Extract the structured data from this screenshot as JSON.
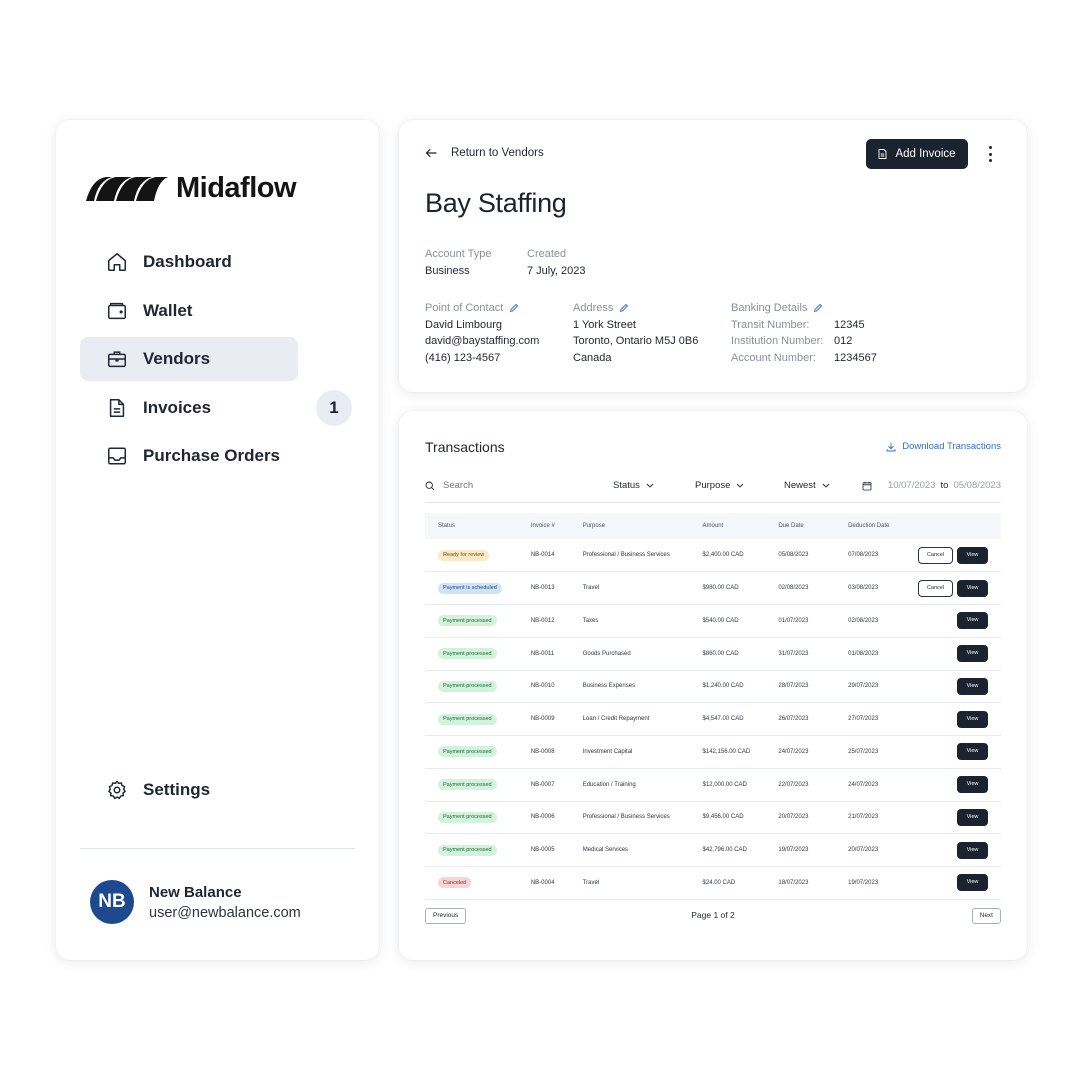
{
  "app": {
    "logo_text": "Midaflow"
  },
  "sidebar": {
    "items": [
      {
        "label": "Dashboard",
        "icon": "home-icon"
      },
      {
        "label": "Wallet",
        "icon": "wallet-icon"
      },
      {
        "label": "Vendors",
        "icon": "briefcase-icon",
        "active": true
      },
      {
        "label": "Invoices",
        "icon": "document-icon",
        "badge": "1"
      },
      {
        "label": "Purchase Orders",
        "icon": "inbox-icon"
      }
    ],
    "settings_label": "Settings",
    "user": {
      "initials": "NB",
      "name": "New Balance",
      "email": "user@newbalance.com"
    }
  },
  "vendor": {
    "back_label": "Return to Vendors",
    "add_invoice_label": "Add Invoice",
    "name": "Bay Staffing",
    "account_type_label": "Account Type",
    "account_type": "Business",
    "created_label": "Created",
    "created": "7 July, 2023",
    "contact_label": "Point of Contact",
    "contact_name": "David Limbourg",
    "contact_email": "david@baystaffing.com",
    "contact_phone": "(416) 123-4567",
    "address_label": "Address",
    "address_line1": "1 York Street",
    "address_line2": "Toronto, Ontario M5J 0B6",
    "address_line3": "Canada",
    "banking_label": "Banking Details",
    "transit_label": "Transit Number:",
    "transit": "12345",
    "institution_label": "Institution Number:",
    "institution": "012",
    "account_label": "Account Number:",
    "account": "1234567"
  },
  "transactions": {
    "title": "Transactions",
    "download_label": "Download Transactions",
    "search_placeholder": "Search",
    "status_filter": "Status",
    "purpose_filter": "Purpose",
    "sort": "Newest",
    "date_from": "10/07/2023",
    "date_to_label": "to",
    "date_to": "05/08/2023",
    "columns": [
      "Status",
      "Invoice #",
      "Purpose",
      "Amount",
      "Due Date",
      "Deduction Date"
    ],
    "cancel_label": "Cancel",
    "view_label": "View",
    "rows": [
      {
        "status": "Ready for review",
        "kind": "review",
        "invoice": "NB-0014",
        "purpose": "Professional / Business Services",
        "amount": "$2,400.00 CAD",
        "due": "05/08/2023",
        "deduction": "07/08/2023",
        "cancel": true
      },
      {
        "status": "Payment is scheduled",
        "kind": "scheduled",
        "invoice": "NB-0013",
        "purpose": "Travel",
        "amount": "$980.00 CAD",
        "due": "02/08/2023",
        "deduction": "03/08/2023",
        "cancel": true
      },
      {
        "status": "Payment processed",
        "kind": "processed",
        "invoice": "NB-0012",
        "purpose": "Taxes",
        "amount": "$540.00 CAD",
        "due": "01/07/2023",
        "deduction": "02/08/2023",
        "cancel": false
      },
      {
        "status": "Payment processed",
        "kind": "processed",
        "invoice": "NB-0011",
        "purpose": "Goods Purchased",
        "amount": "$860.00 CAD",
        "due": "31/07/2023",
        "deduction": "01/08/2023",
        "cancel": false
      },
      {
        "status": "Payment processed",
        "kind": "processed",
        "invoice": "NB-0010",
        "purpose": "Business Expenses",
        "amount": "$1,240.00 CAD",
        "due": "28/07/2023",
        "deduction": "29/07/2023",
        "cancel": false
      },
      {
        "status": "Payment processed",
        "kind": "processed",
        "invoice": "NB-0009",
        "purpose": "Loan / Credit Repayment",
        "amount": "$4,547.00 CAD",
        "due": "26/07/2023",
        "deduction": "27/07/2023",
        "cancel": false
      },
      {
        "status": "Payment processed",
        "kind": "processed",
        "invoice": "NB-0008",
        "purpose": "Investment Capital",
        "amount": "$142,156.00 CAD",
        "due": "24/07/2023",
        "deduction": "25/07/2023",
        "cancel": false
      },
      {
        "status": "Payment processed",
        "kind": "processed",
        "invoice": "NB-0007",
        "purpose": "Education / Training",
        "amount": "$12,000.00 CAD",
        "due": "22/07/2023",
        "deduction": "24/07/2023",
        "cancel": false
      },
      {
        "status": "Payment processed",
        "kind": "processed",
        "invoice": "NB-0006",
        "purpose": "Professional / Business Services",
        "amount": "$9,456.00 CAD",
        "due": "20/07/2023",
        "deduction": "21/07/2023",
        "cancel": false
      },
      {
        "status": "Payment processed",
        "kind": "processed",
        "invoice": "NB-0005",
        "purpose": "Medical Services",
        "amount": "$42,796.00 CAD",
        "due": "19/07/2023",
        "deduction": "20/07/2023",
        "cancel": false
      },
      {
        "status": "Canceled",
        "kind": "canceled",
        "invoice": "NB-0004",
        "purpose": "Travel",
        "amount": "$24.00 CAD",
        "due": "18/07/2023",
        "deduction": "19/07/2023",
        "cancel": false
      }
    ],
    "previous_label": "Previous",
    "page_info": "Page 1 of 2",
    "next_label": "Next"
  },
  "colors": {
    "primary_dark": "#1b2230",
    "accent_blue": "#2f6fd1",
    "avatar_blue": "#1d4a8f",
    "active_nav_bg": "#e9edf3"
  }
}
